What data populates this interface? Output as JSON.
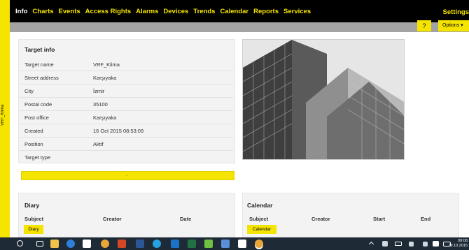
{
  "side_label": "VRF_Klima",
  "nav": {
    "items": [
      "Info",
      "Charts",
      "Events",
      "Access Rights",
      "Alarms",
      "Devices",
      "Trends",
      "Calendar",
      "Reports",
      "Services"
    ],
    "settings": "Settings"
  },
  "toolbar": {
    "help": "?",
    "options": "Options ▾"
  },
  "target_info": {
    "title": "Target info",
    "rows": [
      {
        "label": "Target name",
        "value": "VRF_Klima"
      },
      {
        "label": "Street address",
        "value": "Karşıyaka"
      },
      {
        "label": "City",
        "value": "İzmir"
      },
      {
        "label": "Postal code",
        "value": "35100"
      },
      {
        "label": "Post office",
        "value": "Karşıyaka"
      },
      {
        "label": "Created",
        "value": "16 Oct 2015 08:53:09"
      },
      {
        "label": "Position",
        "value": "Aktif"
      },
      {
        "label": "Target type",
        "value": ""
      }
    ]
  },
  "expand_chevron": "⌄",
  "diary": {
    "title": "Diary",
    "columns": [
      "Subject",
      "Creator",
      "Date"
    ],
    "button": "Diary"
  },
  "calendar": {
    "title": "Calendar",
    "columns": [
      "Subject",
      "Creator",
      "Start",
      "End"
    ],
    "button": "Calendar"
  },
  "taskbar": {
    "time": "09:08",
    "date": "19.10.2015"
  },
  "colors": {
    "accent": "#f5e400",
    "nav_bg": "#000000",
    "taskbar_bg": "#1e2a36"
  }
}
